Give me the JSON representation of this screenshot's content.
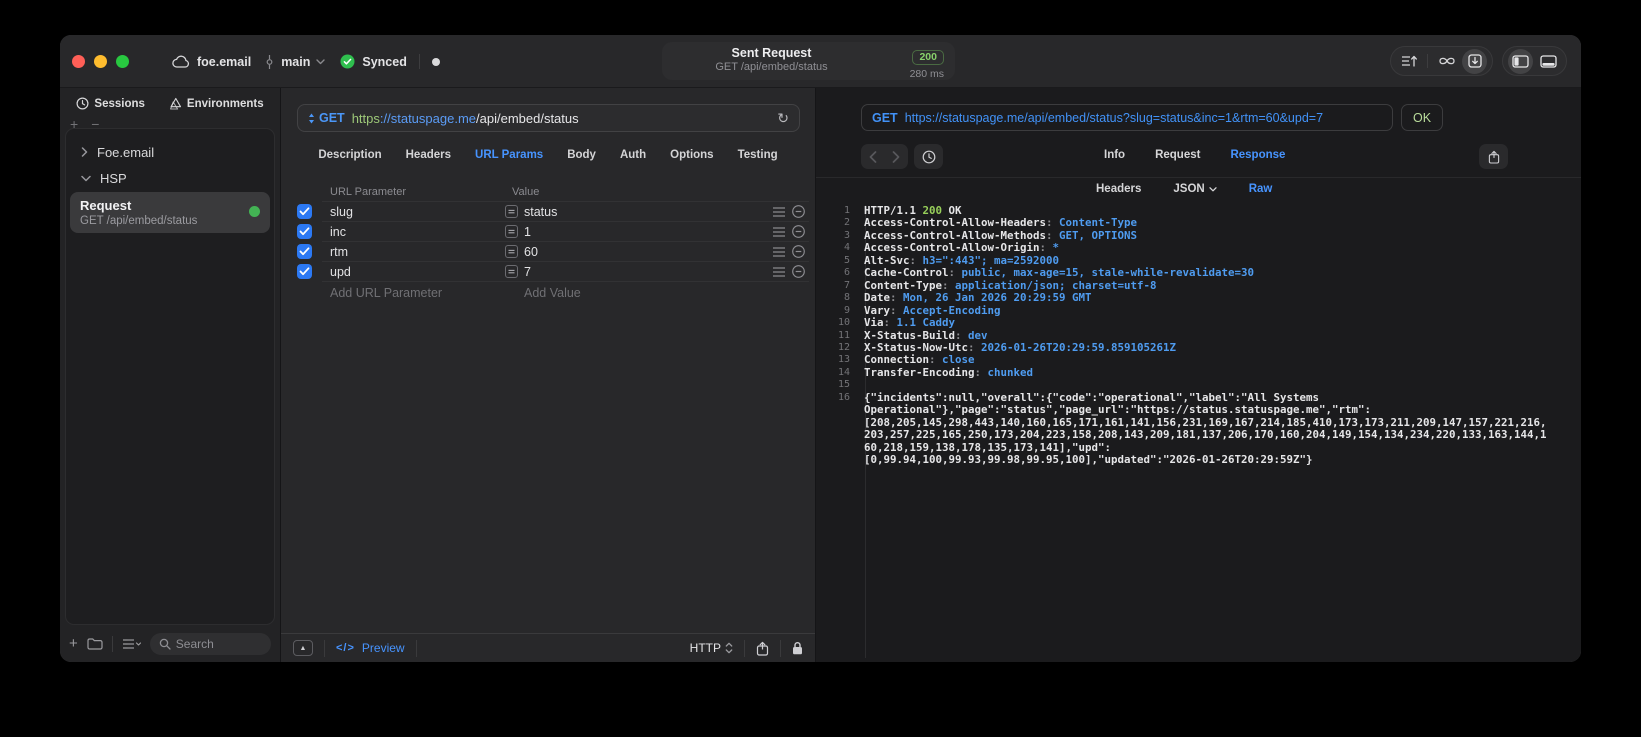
{
  "colors": {
    "accent_blue": "#4794ff",
    "status_green": "#8fd05f",
    "checkbox_blue": "#2c79f4",
    "scheme_green": "#9dc878"
  },
  "glyphs": {
    "add": "+",
    "remove": "−",
    "refresh": "↻",
    "collapse": "▲"
  },
  "titlebar": {
    "workspace": "foe.email",
    "branch": "main",
    "sync_status": "Synced",
    "request_title": "Sent Request",
    "request_subtitle": "GET /api/embed/status",
    "status_code": "200",
    "duration": "280 ms"
  },
  "sidebar": {
    "tabs": [
      {
        "label": "Sessions"
      },
      {
        "label": "Environments"
      }
    ],
    "tree": {
      "group1": "Foe.email",
      "group2": "HSP",
      "request": {
        "title": "Request",
        "subtitle": "GET /api/embed/status"
      }
    },
    "search_placeholder": "Search"
  },
  "request_panel": {
    "method": "GET",
    "url_scheme": "https",
    "url_host": "://statuspage.me",
    "url_path": "/api/embed/status",
    "tabs": [
      {
        "label": "Description"
      },
      {
        "label": "Headers"
      },
      {
        "label": "URL Params",
        "active": true
      },
      {
        "label": "Body"
      },
      {
        "label": "Auth"
      },
      {
        "label": "Options"
      },
      {
        "label": "Testing"
      }
    ],
    "table": {
      "col_param": "URL Parameter",
      "col_value": "Value",
      "rows": [
        {
          "key": "slug",
          "value": "status"
        },
        {
          "key": "inc",
          "value": "1"
        },
        {
          "key": "rtm",
          "value": "60"
        },
        {
          "key": "upd",
          "value": "7"
        }
      ],
      "add_param": "Add URL Parameter",
      "add_value": "Add Value"
    },
    "footer": {
      "code_glyph": "</>",
      "preview_label": "Preview",
      "protocol": "HTTP"
    }
  },
  "response_panel": {
    "method": "GET",
    "url": "https://statuspage.me/api/embed/status?slug=status&inc=1&rtm=60&upd=7",
    "status_code": "200",
    "status_text": "OK",
    "tabs": [
      {
        "label": "Info"
      },
      {
        "label": "Request"
      },
      {
        "label": "Response",
        "active": true
      }
    ],
    "subtabs": [
      {
        "label": "Headers"
      },
      {
        "label": "JSON"
      },
      {
        "label": "Raw",
        "active": true
      }
    ],
    "lines": [
      {
        "n": "1",
        "segs": [
          {
            "t": "HTTP/1.1 ",
            "c": "k"
          },
          {
            "t": "200",
            "c": "g"
          },
          {
            "t": " OK",
            "c": "k"
          }
        ]
      },
      {
        "n": "2",
        "segs": [
          {
            "t": "Access-Control-Allow-Headers",
            "c": "k"
          },
          {
            "t": ": ",
            "c": "p"
          },
          {
            "t": "Content-Type",
            "c": "v"
          }
        ]
      },
      {
        "n": "3",
        "segs": [
          {
            "t": "Access-Control-Allow-Methods",
            "c": "k"
          },
          {
            "t": ": ",
            "c": "p"
          },
          {
            "t": "GET, OPTIONS",
            "c": "v"
          }
        ]
      },
      {
        "n": "4",
        "segs": [
          {
            "t": "Access-Control-Allow-Origin",
            "c": "k"
          },
          {
            "t": ": ",
            "c": "p"
          },
          {
            "t": "*",
            "c": "v"
          }
        ]
      },
      {
        "n": "5",
        "segs": [
          {
            "t": "Alt-Svc",
            "c": "k"
          },
          {
            "t": ": ",
            "c": "p"
          },
          {
            "t": "h3=\":443\"; ma=2592000",
            "c": "v"
          }
        ]
      },
      {
        "n": "6",
        "segs": [
          {
            "t": "Cache-Control",
            "c": "k"
          },
          {
            "t": ": ",
            "c": "p"
          },
          {
            "t": "public, max-age=15, stale-while-revalidate=30",
            "c": "v"
          }
        ]
      },
      {
        "n": "7",
        "segs": [
          {
            "t": "Content-Type",
            "c": "k"
          },
          {
            "t": ": ",
            "c": "p"
          },
          {
            "t": "application/json; charset=utf-8",
            "c": "v"
          }
        ]
      },
      {
        "n": "8",
        "segs": [
          {
            "t": "Date",
            "c": "k"
          },
          {
            "t": ": ",
            "c": "p"
          },
          {
            "t": "Mon, 26 Jan 2026 20:29:59 GMT",
            "c": "v"
          }
        ]
      },
      {
        "n": "9",
        "segs": [
          {
            "t": "Vary",
            "c": "k"
          },
          {
            "t": ": ",
            "c": "p"
          },
          {
            "t": "Accept-Encoding",
            "c": "v"
          }
        ]
      },
      {
        "n": "10",
        "segs": [
          {
            "t": "Via",
            "c": "k"
          },
          {
            "t": ": ",
            "c": "p"
          },
          {
            "t": "1.1 Caddy",
            "c": "v"
          }
        ]
      },
      {
        "n": "11",
        "segs": [
          {
            "t": "X-Status-Build",
            "c": "k"
          },
          {
            "t": ": ",
            "c": "p"
          },
          {
            "t": "dev",
            "c": "v"
          }
        ]
      },
      {
        "n": "12",
        "segs": [
          {
            "t": "X-Status-Now-Utc",
            "c": "k"
          },
          {
            "t": ": ",
            "c": "p"
          },
          {
            "t": "2026-01-26T20:29:59.859105261Z",
            "c": "v"
          }
        ]
      },
      {
        "n": "13",
        "segs": [
          {
            "t": "Connection",
            "c": "k"
          },
          {
            "t": ": ",
            "c": "p"
          },
          {
            "t": "close",
            "c": "v"
          }
        ]
      },
      {
        "n": "14",
        "segs": [
          {
            "t": "Transfer-Encoding",
            "c": "k"
          },
          {
            "t": ": ",
            "c": "p"
          },
          {
            "t": "chunked",
            "c": "v"
          }
        ]
      },
      {
        "n": "15",
        "segs": []
      },
      {
        "n": "16",
        "c": "k",
        "wrap": [
          "{\"incidents\":null,\"overall\":{\"code\":\"operational\",\"label\":\"All Systems",
          "Operational\"},\"page\":\"status\",\"page_url\":\"https://status.statuspage.me\",\"rtm\":",
          "[208,205,145,298,443,140,160,165,171,161,141,156,231,169,167,214,185,410,173,173,211,209,147,157,221,216,",
          "203,257,225,165,250,173,204,223,158,208,143,209,181,137,206,170,160,204,149,154,134,234,220,133,163,144,1",
          "60,218,159,138,178,135,173,141],\"upd\":",
          "[0,99.94,100,99.93,99.98,99.95,100],\"updated\":\"2026-01-26T20:29:59Z\"}"
        ]
      }
    ]
  }
}
